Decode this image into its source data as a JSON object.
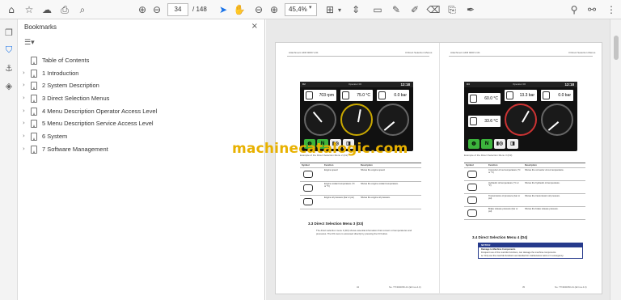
{
  "toolbar": {
    "icons": [
      "home-icon",
      "star-icon",
      "upload-cloud-icon",
      "print-icon",
      "zoom-icon",
      "page-up-icon",
      "page-down-icon",
      "select-cursor-icon",
      "hand-icon",
      "zoom-out-icon",
      "zoom-in-icon",
      "fit-page-icon",
      "scroll-mode-icon",
      "comment-icon",
      "highlight-icon",
      "draw-icon",
      "erase-icon",
      "stamp-icon",
      "sign-icon",
      "share-icon",
      "more-icon"
    ],
    "current_page": "34",
    "total_pages": "/ 148",
    "zoom": "45,4%"
  },
  "leftrail": {
    "icons": [
      "pages-icon",
      "bookmark-icon",
      "attachment-icon",
      "layers-icon"
    ]
  },
  "bookmarks": {
    "title": "Bookmarks",
    "close_glyph": "×",
    "options_glyph": "☰▾",
    "items": [
      {
        "label": "Table of Contents",
        "expandable": false
      },
      {
        "label": "1 Introduction",
        "expandable": true
      },
      {
        "label": "2 System Description",
        "expandable": true
      },
      {
        "label": "3 Direct Selection Menus",
        "expandable": true
      },
      {
        "label": "4 Menu Description Operator Access Level",
        "expandable": true
      },
      {
        "label": "5 Menu Description Service Access Level",
        "expandable": true
      },
      {
        "label": "6 System",
        "expandable": true
      },
      {
        "label": "7 Software Management",
        "expandable": true
      }
    ]
  },
  "document": {
    "watermark": "machinecatalogic.com",
    "left_page": {
      "header_left": "Attachment AFM 9000 V-01",
      "header_right": "3 Direct Selection Menus",
      "screen": {
        "status_left": "D2",
        "status_mid": "Operator 00",
        "status_day": "Wednesday",
        "time": "12:18",
        "gauges": [
          {
            "value": "703",
            "unit": "rpm"
          },
          {
            "value": "75.0",
            "unit": "°C"
          },
          {
            "value": "0.0",
            "unit": "bar"
          }
        ],
        "keys": [
          "◍",
          "N",
          "▮◎",
          "◨"
        ]
      },
      "caption": "Example of the Direct Selection Menu 2 (D2)",
      "table": {
        "headers": [
          "Symbol",
          "Function",
          "Description"
        ],
        "rows": [
          {
            "function": "Engine speed",
            "description": "Shows the engine speed."
          },
          {
            "function": "Engine coolant temperature (°C or °F)",
            "description": "Shows the engine coolant temperature."
          },
          {
            "function": "Engine oil pressure (bar or psi)",
            "description": "Shows the engine oil pressure."
          }
        ]
      },
      "section_title": "3.3  Direct Selection Menu 3 (D3)",
      "paragraph": "The direct selection menu 3 (D3) shows essential information that concern oil temperatures and pressures. The D3 menu is accessed directly by pressing the F3 button.",
      "footer_left": "34",
      "footer_right": "No. TTN000050-01 (EN rev.4.0)"
    },
    "right_page": {
      "header_left": "Attachment AFM 9000 V-01",
      "header_right": "3 Direct Selection Menus",
      "screen": {
        "status_left": "D3",
        "status_mid": "Operator 00",
        "status_day": "Wednesday",
        "time": "12:18",
        "gauges": [
          {
            "value": "60.0",
            "unit": "°C"
          },
          {
            "value": "13.3",
            "unit": "bar"
          },
          {
            "value": "0.0",
            "unit": "bar"
          },
          {
            "value": "33.6",
            "unit": "°C"
          }
        ],
        "keys": [
          "◍",
          "N",
          "▮◎",
          "◨"
        ]
      },
      "caption": "Example of the Direct Selection Menu 3 (D3)",
      "table": {
        "headers": [
          "Symbol",
          "Function",
          "Description"
        ],
        "rows": [
          {
            "function": "Converter oil out temperature (°C or °F)",
            "description": "Shows the converter oil out temperature."
          },
          {
            "function": "Hydraulic oil temperature (°C or °F)",
            "description": "Shows the hydraulic oil temperature."
          },
          {
            "function": "Transmission oil pressure (bar or psi)",
            "description": "Shows the transmission oil pressure."
          },
          {
            "function": "Brake release pressure (bar or psi)",
            "description": "Shows the brake release pressure."
          }
        ]
      },
      "section_title": "3.4  Direct Selection Menu 4 (D4)",
      "notice": {
        "title": "NOTICE",
        "heading": "Damage to Machine Components",
        "line1": "Frequent use of the override functions, can damage the machine components.",
        "line2": "► Only use the override functions as intended for maintenance work or in emergency."
      },
      "footer_left": "35",
      "footer_right": "No. TTN000050-01 (EN rev.4.0)"
    }
  },
  "colors": {
    "accent": "#1a73e8",
    "watermark": "#e8b100",
    "notice": "#263a8c",
    "key_green": "#3cb43c"
  }
}
